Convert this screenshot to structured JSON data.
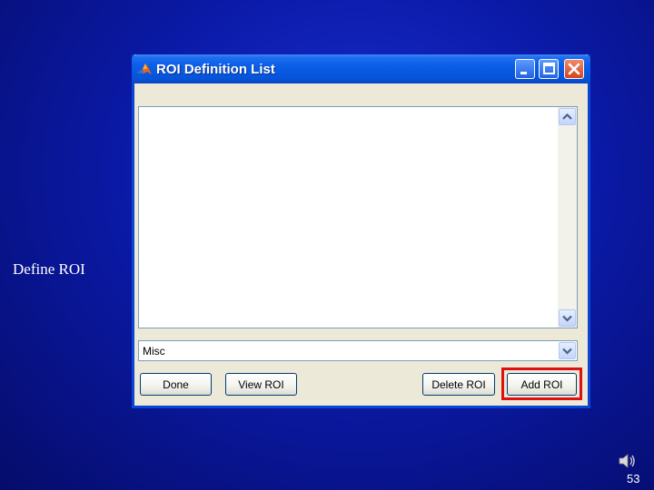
{
  "slide": {
    "label": "Define ROI",
    "page_number": "53"
  },
  "window": {
    "title": "ROI Definition List",
    "controls": [
      "minimize-icon",
      "maximize-icon",
      "close-icon"
    ]
  },
  "list": {
    "items": []
  },
  "dropdown": {
    "value": "Misc"
  },
  "buttons": {
    "done": "Done",
    "view_roi": "View ROI",
    "delete_roi": "Delete ROI",
    "add_roi": "Add ROI"
  },
  "colors": {
    "highlight": "#e01010",
    "titlebar": "#0a5ee6",
    "background": "#0b1aa8"
  }
}
